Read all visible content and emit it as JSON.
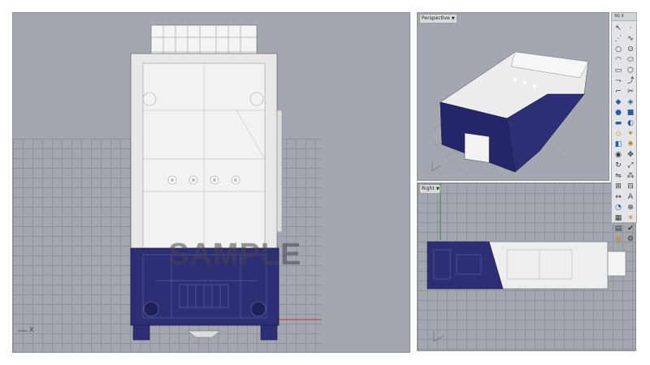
{
  "viewports": {
    "top": {
      "axis_label": "X",
      "watermark": "SAMPLE"
    },
    "perspective": {
      "label": "Perspective"
    },
    "right": {
      "label": "Right"
    }
  },
  "toolbar": {
    "title": "ℜΰ Ⅹ",
    "tools": [
      {
        "name": "select-arrow-icon",
        "glyph": "↖",
        "color": "#333333"
      },
      {
        "name": "point-icon",
        "glyph": "·",
        "color": "#333333"
      },
      {
        "name": "polyline-icon",
        "glyph": "⋰",
        "color": "#333333"
      },
      {
        "name": "curve-icon",
        "glyph": "∿",
        "color": "#333333"
      },
      {
        "name": "circle-icon",
        "glyph": "○",
        "color": "#333333"
      },
      {
        "name": "circle-center-icon",
        "glyph": "⊙",
        "color": "#333333"
      },
      {
        "name": "arc-icon",
        "glyph": "◠",
        "color": "#333333"
      },
      {
        "name": "ellipse-icon",
        "glyph": "⬭",
        "color": "#333333"
      },
      {
        "name": "rectangle-icon",
        "glyph": "▭",
        "color": "#333333"
      },
      {
        "name": "polygon-icon",
        "glyph": "⬡",
        "color": "#333333"
      },
      {
        "name": "curve-tools-icon",
        "glyph": "⤳",
        "color": "#333333"
      },
      {
        "name": "offset-icon",
        "glyph": "⤴",
        "color": "#333333"
      },
      {
        "name": "fillet-icon",
        "glyph": "⌐",
        "color": "#333333"
      },
      {
        "name": "trim-icon",
        "glyph": "✂",
        "color": "#333333"
      },
      {
        "name": "surface-icon",
        "glyph": "◆",
        "color": "#2a58a8"
      },
      {
        "name": "surface-edit-icon",
        "glyph": "◈",
        "color": "#2a58a8"
      },
      {
        "name": "sphere-icon",
        "glyph": "●",
        "color": "#2a58a8"
      },
      {
        "name": "solid-box-icon",
        "glyph": "■",
        "color": "#2a58a8"
      },
      {
        "name": "cylinder-icon",
        "glyph": "▬",
        "color": "#2a58a8"
      },
      {
        "name": "boolean-icon",
        "glyph": "◐",
        "color": "#2a58a8"
      },
      {
        "name": "mesh-icon",
        "glyph": "◇",
        "color": "#c98a14"
      },
      {
        "name": "render-icon",
        "glyph": "✦",
        "color": "#c98a14"
      },
      {
        "name": "layer-icon",
        "glyph": "◧",
        "color": "#2a58a8"
      },
      {
        "name": "light-icon",
        "glyph": "✸",
        "color": "#c98a14"
      },
      {
        "name": "drop-icon",
        "glyph": "◉",
        "color": "#333333"
      },
      {
        "name": "move-icon",
        "glyph": "✥",
        "color": "#333333"
      },
      {
        "name": "rotate-icon",
        "glyph": "↻",
        "color": "#333333"
      },
      {
        "name": "scale-icon",
        "glyph": "⤢",
        "color": "#333333"
      },
      {
        "name": "mirror-icon",
        "glyph": "⇋",
        "color": "#333333"
      },
      {
        "name": "array-icon",
        "glyph": "⁂",
        "color": "#333333"
      },
      {
        "name": "group-icon",
        "glyph": "⊞",
        "color": "#333333"
      },
      {
        "name": "ungroup-icon",
        "glyph": "⊟",
        "color": "#333333"
      },
      {
        "name": "dimension-icon",
        "glyph": "↔",
        "color": "#333333"
      },
      {
        "name": "text-icon",
        "glyph": "A",
        "color": "#333333"
      },
      {
        "name": "analyze-icon",
        "glyph": "◔",
        "color": "#2a58a8"
      },
      {
        "name": "osnap-icon",
        "glyph": "⊕",
        "color": "#333333"
      },
      {
        "name": "grid-icon",
        "glyph": "▦",
        "color": "#333333"
      },
      {
        "name": "sun-icon",
        "glyph": "☀",
        "color": "#c98a14"
      },
      {
        "name": "properties-icon",
        "glyph": "▤",
        "color": "#333333"
      },
      {
        "name": "check-icon",
        "glyph": "✔",
        "color": "#333333"
      },
      {
        "name": "render-preview-icon",
        "glyph": "◍",
        "color": "#c98a14"
      },
      {
        "name": "options-icon",
        "glyph": "⚙",
        "color": "#333333"
      }
    ]
  }
}
